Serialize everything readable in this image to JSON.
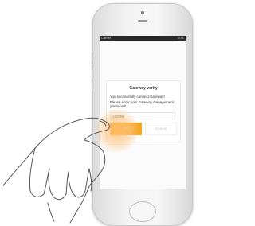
{
  "status_bar": {
    "left": "Carrier",
    "right": "9:41"
  },
  "dialog": {
    "title": "Gateway verify",
    "line1": "You successfully connect Gateway!",
    "line2": "Please enter your Gateway management password!",
    "password_value": "123456",
    "ok_label": "OK",
    "cancel_label": "Cancel"
  },
  "colors": {
    "accent": "#f5a623",
    "cancel_text": "#c8c8c8"
  }
}
